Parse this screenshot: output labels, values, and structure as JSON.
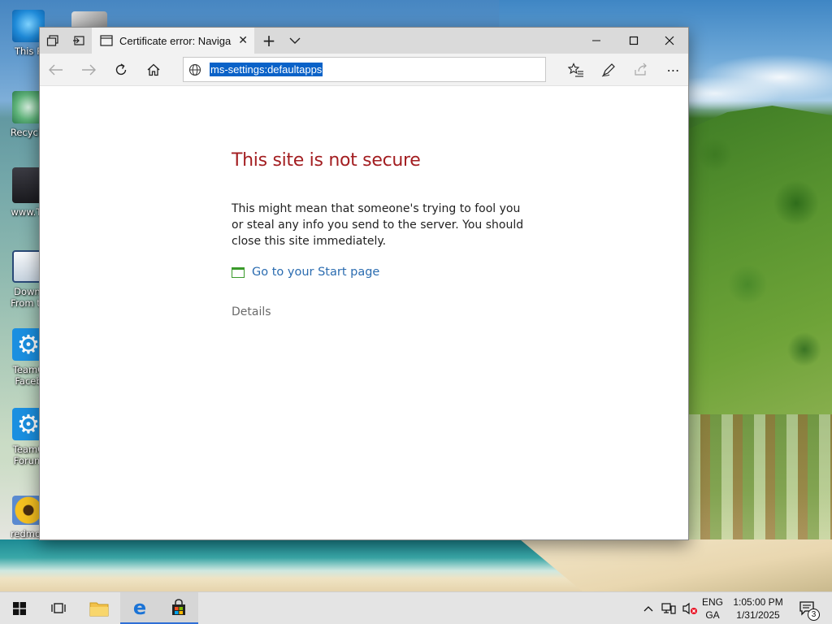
{
  "desktop": {
    "icons": [
      {
        "label": "This P",
        "icon": "this-pc-icon"
      },
      {
        "label": "Recycle",
        "icon": "recycle-bin-icon"
      },
      {
        "label": "www.Te",
        "icon": "shortcut-icon"
      },
      {
        "label": "Downl\nFrom te",
        "icon": "document-icon"
      },
      {
        "label": "TeamC\nFaceb",
        "icon": "gear-icon"
      },
      {
        "label": "TeamC\nForum",
        "icon": "gear-icon"
      },
      {
        "label": "redmoo",
        "icon": "flower-image-icon"
      }
    ]
  },
  "browser": {
    "tab": {
      "title": "Certificate error: Naviga"
    },
    "address": {
      "url": "ms-settings:defaultapps"
    },
    "page": {
      "title": "This site is not secure",
      "body": "This might mean that someone's trying to fool you or steal any info you send to the server. You should close this site immediately.",
      "link": "Go to your Start page",
      "details": "Details"
    }
  },
  "taskbar": {
    "lang_top": "ENG",
    "lang_bottom": "GA",
    "time": "1:05:00 PM",
    "date": "1/31/2025",
    "notification_count": "3"
  },
  "colors": {
    "error_title": "#a31e21",
    "link": "#2b6cb0",
    "selection": "#0a62c8"
  }
}
